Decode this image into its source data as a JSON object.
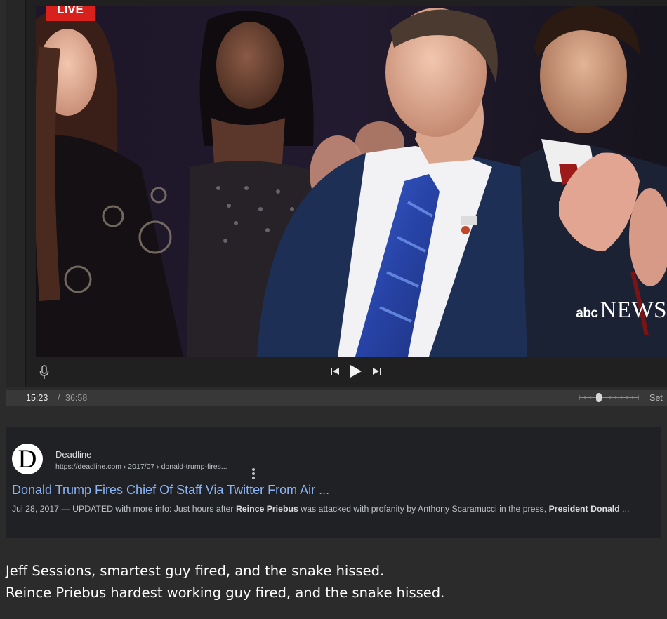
{
  "player": {
    "badge": "LIVE",
    "network_logo_small": "abc",
    "network_logo_large": "NEWS",
    "controls": {
      "mic_icon": "microphone-icon",
      "prev_icon": "skip-previous-icon",
      "play_icon": "play-icon",
      "next_icon": "skip-next-icon"
    },
    "time": {
      "current": "15:23",
      "separator": "/",
      "total": "36:58"
    },
    "settings_label": "Set"
  },
  "result": {
    "logo_letter": "D",
    "site_name": "Deadline",
    "url": "https://deadline.com › 2017/07 › donald-trump-fires...",
    "title": "Donald Trump Fires Chief Of Staff Via Twitter From Air ...",
    "snippet": {
      "part1": "Jul 28, 2017 — UPDATED with more info: Just hours after ",
      "bold1": "Reince Priebus",
      "part2": " was attacked with profanity by Anthony Scaramucci in the press, ",
      "bold2": "President Donald",
      "part3": " ..."
    },
    "colors": {
      "title": "#8ab4f8",
      "card_background": "#202124"
    }
  },
  "caption": {
    "line1": "Jeff Sessions, smartest guy fired, and the snake hissed.",
    "line2": "Reince Priebus hardest working guy fired, and the snake hissed."
  }
}
